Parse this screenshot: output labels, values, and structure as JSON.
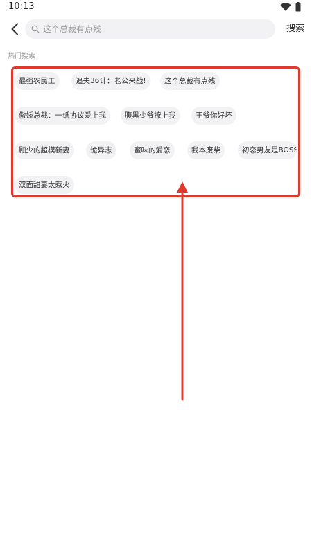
{
  "status_bar": {
    "time": "10:13",
    "icons": [
      "wifi-icon",
      "battery-icon"
    ]
  },
  "search": {
    "back_icon": "chevron-left-icon",
    "search_icon": "search-icon",
    "placeholder": "这个总裁有点残",
    "value": "",
    "button_label": "搜索"
  },
  "hot_search": {
    "title": "热门搜索",
    "tags": [
      "最强农民工",
      "追夫36计：老公来战!",
      "这个总裁有点残",
      "傲娇总裁：一纸协议爱上我",
      "腹黑少爷撩上我",
      "王爷你好坏",
      "顾少的超模新妻",
      "诡异志",
      "蜜味的爱恋",
      "我本废柴",
      "初恋男友是BOSS",
      "双面甜妻太惹火"
    ]
  },
  "colors": {
    "annotation": "#e03a2f",
    "tag_background": "#f2f2f4",
    "secondary_text": "#9a9a9a"
  }
}
